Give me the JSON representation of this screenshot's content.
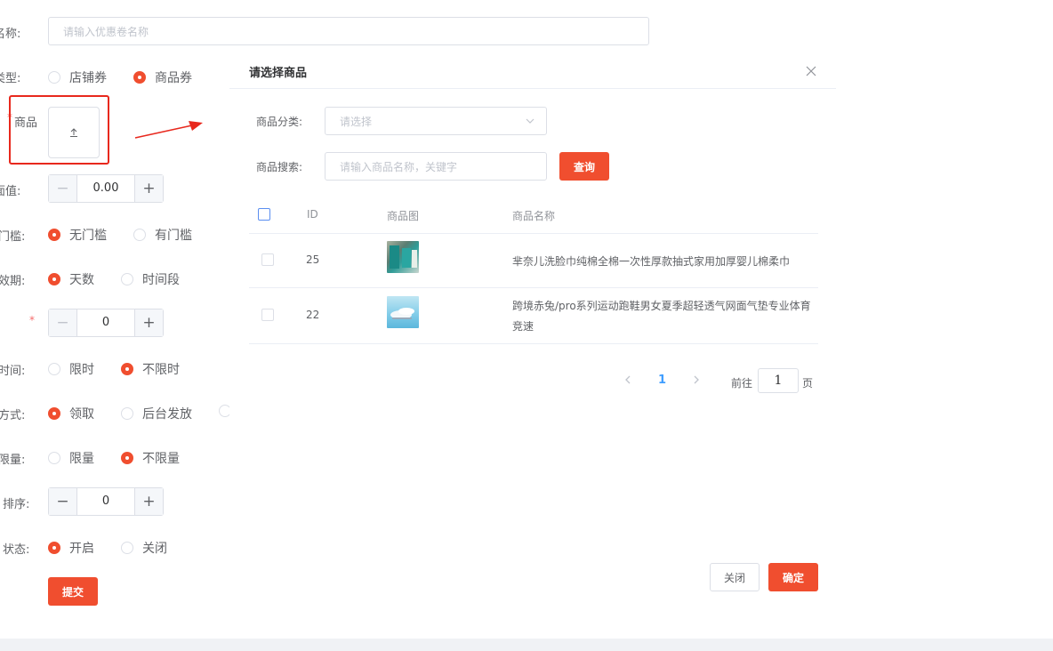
{
  "form": {
    "name_label": "券名称:",
    "name_placeholder": "请输入优惠卷名称",
    "type_label": "券类型:",
    "type_options": [
      "店铺券",
      "商品券"
    ],
    "product_label": "商品",
    "product_required": "*",
    "face_label": "券面值:",
    "face_value": "0.00",
    "threshold_label": "使用门槛:",
    "threshold_options": [
      "无门槛",
      "有门槛"
    ],
    "validity_label": "有效期:",
    "validity_options": [
      "天数",
      "时间段"
    ],
    "days_required": "*",
    "days_value": "0",
    "claim_time_label": "领取时间:",
    "claim_time_options": [
      "限时",
      "不限时"
    ],
    "claim_method_label": "领取方式:",
    "claim_method_options": [
      "领取",
      "后台发放"
    ],
    "quantity_label": "是否限量:",
    "quantity_options": [
      "限量",
      "不限量"
    ],
    "sort_label": "排序:",
    "sort_value": "0",
    "status_label": "状态:",
    "status_options": [
      "开启",
      "关闭"
    ],
    "submit_label": "提交"
  },
  "dialog": {
    "title": "请选择商品",
    "category_label": "商品分类:",
    "category_placeholder": "请选择",
    "search_label": "商品搜索:",
    "search_placeholder": "请输入商品名称，关键字",
    "query_label": "查询",
    "columns": [
      "ID",
      "商品图",
      "商品名称"
    ],
    "rows": [
      {
        "id": "25",
        "name": "芈奈儿洗脸巾纯棉全棉一次性厚款抽式家用加厚婴儿棉柔巾"
      },
      {
        "id": "22",
        "name_line1": "跨境赤兔/pro系列运动跑鞋男女夏季超轻透气网面气垫专业体育",
        "name_line2": "竞速"
      }
    ],
    "current_page": "1",
    "goto_label": "前往",
    "goto_value": "1",
    "page_unit": "页",
    "close_label": "关闭",
    "confirm_label": "确定"
  },
  "colors": {
    "accent": "#f04e2f",
    "annotation": "#e8281d",
    "border": "#dcdfe6",
    "link": "#409eff"
  }
}
